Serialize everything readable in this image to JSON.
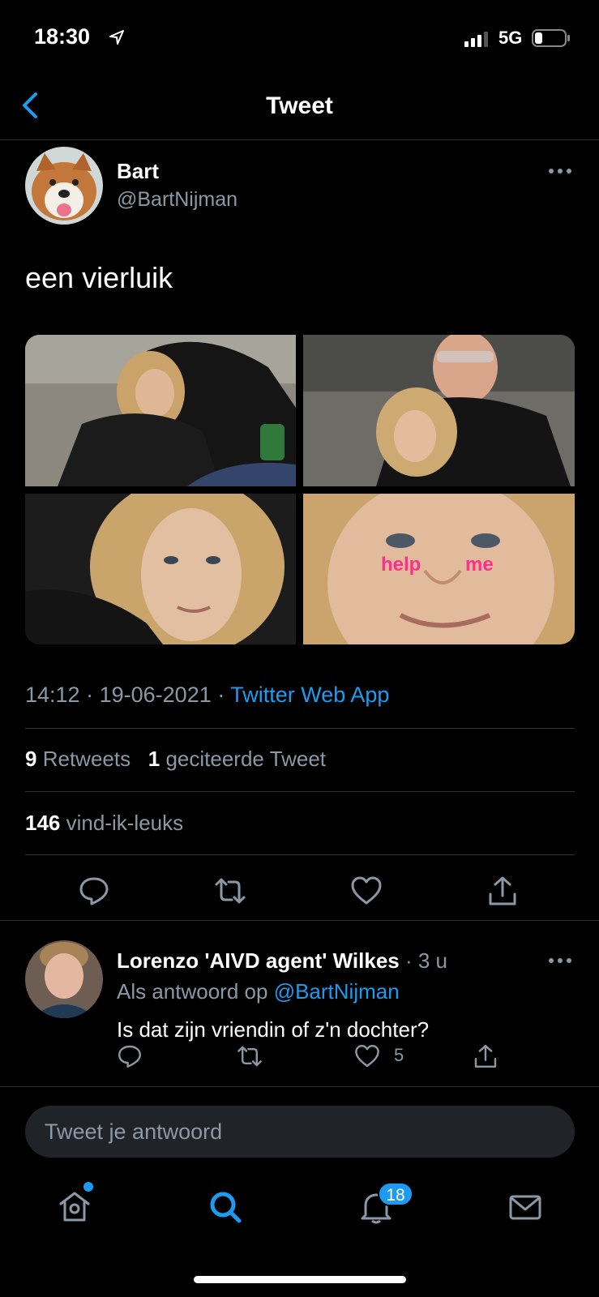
{
  "status_bar": {
    "time": "18:30",
    "network": "5G"
  },
  "nav": {
    "title": "Tweet"
  },
  "tweet": {
    "author_name": "Bart",
    "author_handle": "@BartNijman",
    "text": "een vierluik",
    "photo_overlay": [
      "help",
      "me"
    ],
    "time": "14:12",
    "date": "19-06-2021",
    "source": "Twitter Web App",
    "separator": "·",
    "retweets_count": "9",
    "retweets_label": "Retweets",
    "quotes_count": "1",
    "quotes_label": "geciteerde Tweet",
    "likes_count": "146",
    "likes_label": "vind-ik-leuks"
  },
  "reply": {
    "author_name": "Lorenzo 'AIVD agent' Wilkes",
    "time": "· 3 u",
    "reply_to_prefix": "Als antwoord op",
    "reply_to_handle": "@BartNijman",
    "text": "Is dat zijn vriendin of z'n dochter?",
    "like_count": "5"
  },
  "compose": {
    "placeholder": "Tweet je antwoord"
  },
  "tabbar": {
    "notifications_badge": "18"
  },
  "colors": {
    "accent": "#1d9bf0",
    "background": "#000000",
    "muted": "#8b98a5",
    "overlay_text": "#ff2f8c"
  },
  "icons": [
    "location-arrow-icon",
    "signal-icon",
    "battery-icon",
    "back-chevron-icon",
    "more-dots-icon",
    "reply-icon",
    "retweet-icon",
    "like-icon",
    "share-icon",
    "home-icon",
    "search-icon",
    "bell-icon",
    "mail-icon"
  ]
}
